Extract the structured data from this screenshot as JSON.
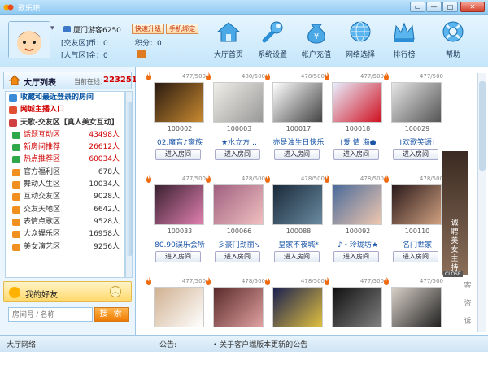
{
  "window": {
    "title": "歌乐吧",
    "controls": {
      "minimize": "▭",
      "restore": "—",
      "maximize": "□",
      "close": "✕"
    }
  },
  "user": {
    "name": "厦门游客6250",
    "coin_label": "[交友区]币：0",
    "fame_label": "[人气区]金：0",
    "score_label": "积分：0",
    "upgrade_btn": "快速升级",
    "bind_btn": "手机绑定"
  },
  "nav": [
    {
      "label": "大厅首页",
      "icon": "home-icon"
    },
    {
      "label": "系统设置",
      "icon": "wrench-icon"
    },
    {
      "label": "帐户充值",
      "icon": "money-bag-icon"
    },
    {
      "label": "网络选择",
      "icon": "globe-icon"
    },
    {
      "label": "排行榜",
      "icon": "crown-icon"
    },
    {
      "label": "帮助",
      "icon": "lifebuoy-icon"
    }
  ],
  "lobby": {
    "title": "大厅列表",
    "online_label": "当前在线：",
    "online_count": "223251"
  },
  "rooms_list": [
    {
      "label": "收藏和最近登录的房间",
      "count": "",
      "style": "b blue",
      "sub": false
    },
    {
      "label": "网城主播入口",
      "count": "",
      "style": "b red",
      "sub": false
    },
    {
      "label": "天歌-交友区【真人美女互动】",
      "count": "",
      "style": "b",
      "sub": false
    },
    {
      "label": "话题互动区",
      "count": "43498人",
      "style": "red",
      "sub": true
    },
    {
      "label": "新房间推荐",
      "count": "26612人",
      "style": "red",
      "sub": true
    },
    {
      "label": "热点推荐区",
      "count": "60034人",
      "style": "red",
      "sub": true
    },
    {
      "label": "官方福利区",
      "count": "678人",
      "style": "",
      "sub": true
    },
    {
      "label": "舞动人生区",
      "count": "10034人",
      "style": "",
      "sub": true
    },
    {
      "label": "互动交友区",
      "count": "9028人",
      "style": "",
      "sub": true
    },
    {
      "label": "交友天地区",
      "count": "6642人",
      "style": "",
      "sub": true
    },
    {
      "label": "表情点歌区",
      "count": "9528人",
      "style": "",
      "sub": true
    },
    {
      "label": "大众娱乐区",
      "count": "16958人",
      "style": "",
      "sub": true
    },
    {
      "label": "美女演艺区",
      "count": "9256人",
      "style": "",
      "sub": true
    }
  ],
  "friends": {
    "title": "我的好友",
    "toggle": "︿"
  },
  "search": {
    "placeholder": "房间号 / 名称",
    "button": "搜 索"
  },
  "rooms": [
    {
      "id": "100002",
      "name": "02.魔音♪家族",
      "occ": "477/500"
    },
    {
      "id": "100003",
      "name": "★水立方…",
      "occ": "480/500"
    },
    {
      "id": "100017",
      "name": "亦是浊生日快乐",
      "occ": "478/500"
    },
    {
      "id": "100018",
      "name": "†爱 情 海●",
      "occ": "477/500"
    },
    {
      "id": "100029",
      "name": "†欢歌笑语†",
      "occ": "477/500"
    },
    {
      "id": "100033",
      "name": "80.90误乐会所",
      "occ": "477/500"
    },
    {
      "id": "100066",
      "name": "彡豪门劲丽↘",
      "occ": "478/500"
    },
    {
      "id": "100088",
      "name": "皇家不夜城*",
      "occ": "478/500"
    },
    {
      "id": "100092",
      "name": "♪・玲珑坊★",
      "occ": "478/500"
    },
    {
      "id": "100110",
      "name": "名门世家",
      "occ": "478/500"
    },
    {
      "id": "",
      "name": "",
      "occ": "477/500"
    },
    {
      "id": "",
      "name": "",
      "occ": "478/500"
    },
    {
      "id": "",
      "name": "",
      "occ": "478/500"
    },
    {
      "id": "",
      "name": "",
      "occ": "477/500"
    },
    {
      "id": "",
      "name": "",
      "occ": "477/500"
    }
  ],
  "enter_label": "进入房间",
  "ad": {
    "text": "诚聘美女主持人",
    "close": "CLOSE"
  },
  "side_text": [
    "客",
    "咨",
    "诉"
  ],
  "status": {
    "left": "大厅网络:",
    "notice_label": "公告:",
    "notice": "关于客户端版本更新的公告"
  }
}
